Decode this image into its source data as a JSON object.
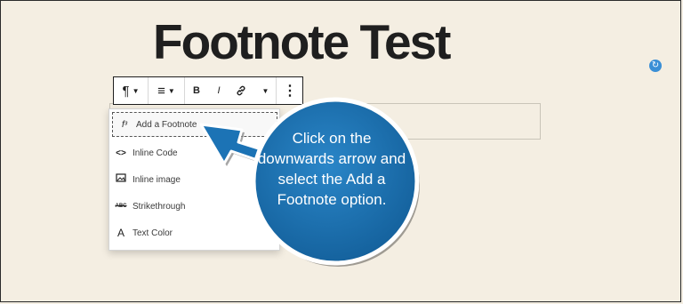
{
  "page": {
    "title": "Footnote Test"
  },
  "toolbar": {
    "buttons": [
      {
        "name": "paragraph-icon",
        "glyph": "¶"
      },
      {
        "name": "align-icon",
        "glyph": "≡"
      },
      {
        "name": "bold-icon",
        "glyph": "B"
      },
      {
        "name": "italic-icon",
        "glyph": "I"
      },
      {
        "name": "link-icon",
        "glyph": "🔗"
      },
      {
        "name": "more-options-icon",
        "glyph": "⋮"
      }
    ]
  },
  "menu": {
    "items": [
      {
        "label": "Add a Footnote",
        "icon": "f³",
        "selected": true
      },
      {
        "label": "Inline Code",
        "icon": "<>"
      },
      {
        "label": "Inline image",
        "icon": "🖼"
      },
      {
        "label": "Strikethrough",
        "icon": "ABC"
      },
      {
        "label": "Text Color",
        "icon": "A"
      }
    ]
  },
  "callout": {
    "text": "Click on the downwards arrow and select the Add a Footnote option.",
    "color": "#1c73b5"
  },
  "colors": {
    "background": "#f4eee2",
    "accent": "#3a8fd6"
  }
}
